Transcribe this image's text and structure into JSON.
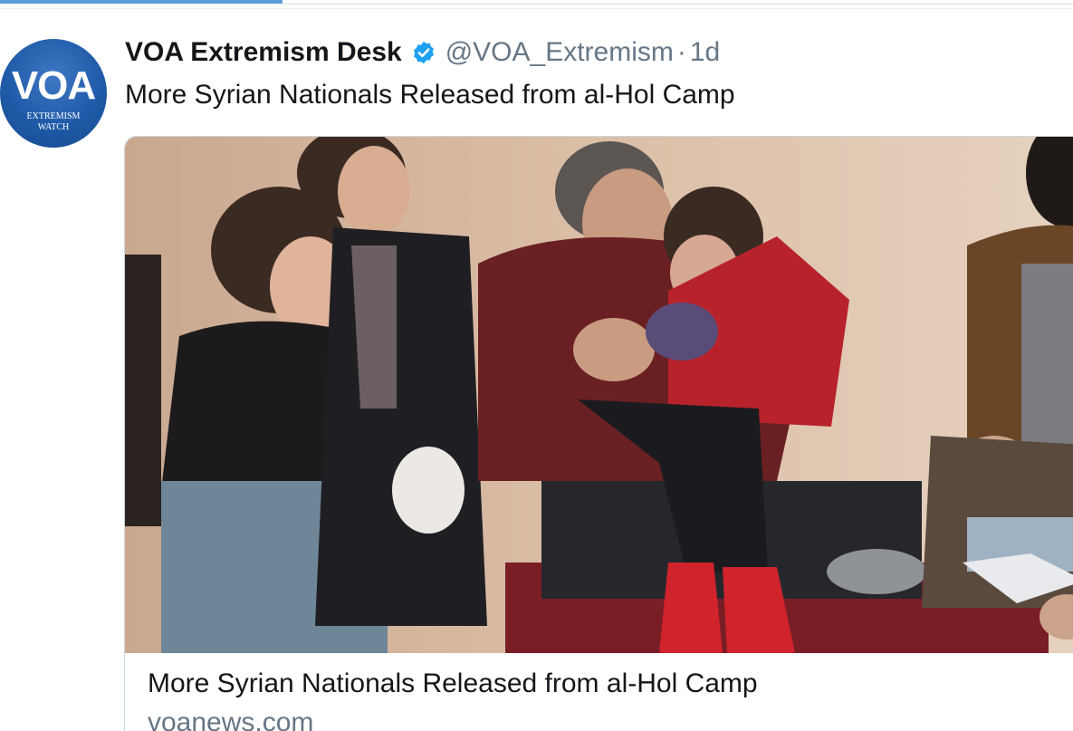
{
  "tweet": {
    "author": {
      "display_name": "VOA Extremism Desk",
      "handle": "@VOA_Extremism",
      "separator": "·",
      "time": "1d",
      "verified": true,
      "avatar": {
        "logo_text": "VOA",
        "sub_line1": "EXTREMISM",
        "sub_line2": "WATCH",
        "color": "#1f5aa8"
      }
    },
    "text": "More Syrian Nationals Released from al-Hol Camp",
    "card": {
      "title": "More Syrian Nationals Released from al-Hol Camp",
      "domain": "voanews.com"
    }
  },
  "colors": {
    "verified": "#1da1f2",
    "muted": "#657786",
    "text": "#14171a",
    "indicator": "#5b9ad6"
  },
  "icons": [
    "verified-badge-icon"
  ]
}
